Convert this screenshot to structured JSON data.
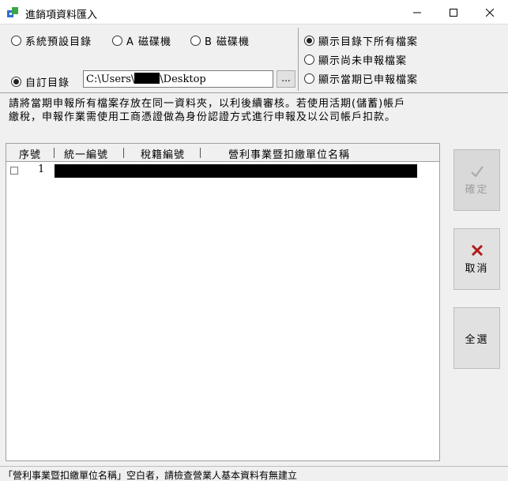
{
  "window": {
    "title": "進銷項資料匯入",
    "icon": "app-data-icon",
    "controls": [
      "minimize-icon",
      "maximize-icon",
      "close-icon"
    ]
  },
  "source_options": {
    "default_dir": "系統預設目錄",
    "drive_a": "A 磁碟機",
    "drive_b": "B 磁碟機",
    "custom_dir": "自訂目錄",
    "selected": "custom_dir"
  },
  "path": {
    "prefix": "C:\\Users\\",
    "suffix": "\\Desktop",
    "browse_label": "..."
  },
  "filter_options": {
    "all": "顯示目錄下所有檔案",
    "unfiled": "顯示尚未申報檔案",
    "filed": "顯示當期已申報檔案",
    "selected": "all"
  },
  "notice": {
    "line1": "請將當期申報所有檔案存放在同一資料夾，以利後續審核。若使用活期(儲蓄)帳戶",
    "line2": "繳稅，申報作業需使用工商憑證做為身份認證方式進行申報及以公司帳戶扣款。"
  },
  "grid": {
    "columns": [
      "序號",
      "統一編號",
      "稅籍編號",
      "營利事業暨扣繳單位名稱"
    ],
    "rows": [
      {
        "seq": "1",
        "checked": false
      }
    ]
  },
  "buttons": {
    "confirm": "確定",
    "cancel": "取消",
    "select_all": "全選"
  },
  "status": {
    "text": "「營利事業暨扣繳單位名稱」空白者，請檢查營業人基本資料有無建立"
  },
  "colors": {
    "cancel_icon": "#b01919",
    "disabled_text": "#9e9e9e",
    "icon_blue": "#2f6fd0",
    "icon_green": "#3aa64a"
  }
}
